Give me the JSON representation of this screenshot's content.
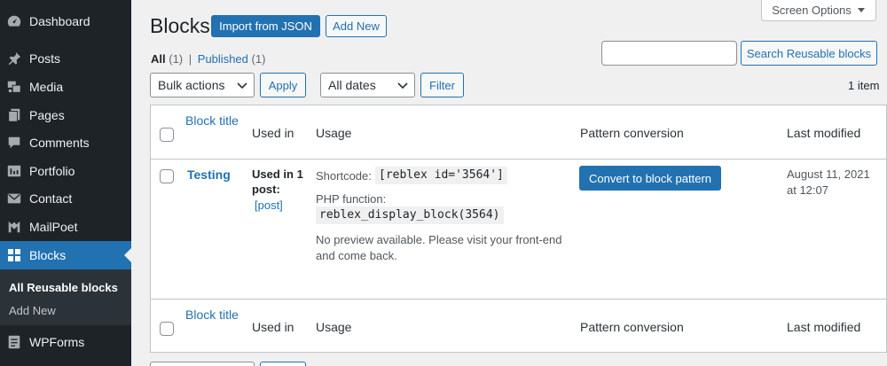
{
  "sidebar": {
    "items": [
      {
        "label": "Dashboard",
        "icon": "dashboard-icon"
      },
      {
        "label": "Posts",
        "icon": "pin-icon"
      },
      {
        "label": "Media",
        "icon": "media-icon"
      },
      {
        "label": "Pages",
        "icon": "pages-icon"
      },
      {
        "label": "Comments",
        "icon": "comment-icon"
      },
      {
        "label": "Portfolio",
        "icon": "portfolio-icon"
      },
      {
        "label": "Contact",
        "icon": "mail-icon"
      },
      {
        "label": "MailPoet",
        "icon": "mailpoet-icon"
      },
      {
        "label": "Blocks",
        "icon": "grid-icon"
      },
      {
        "label": "WPForms",
        "icon": "forms-icon"
      }
    ],
    "submenu": [
      "All Reusable blocks",
      "Add New"
    ]
  },
  "screen_options": "Screen Options",
  "page": {
    "title": "Blocks",
    "import_label": "Import from JSON",
    "add_new_label": "Add New"
  },
  "views": {
    "all_label": "All",
    "all_count": "(1)",
    "separator": "|",
    "published_label": "Published",
    "published_count": "(1)"
  },
  "search": {
    "value": "",
    "button_label": "Search Reusable blocks"
  },
  "filters": {
    "bulk_actions": "Bulk actions",
    "apply_label": "Apply",
    "dates": "All dates",
    "filter_label": "Filter",
    "item_count": "1 item"
  },
  "table": {
    "columns": {
      "title": "Block title",
      "used_in": "Used in",
      "usage": "Usage",
      "pattern": "Pattern conversion",
      "modified": "Last modified"
    },
    "rows": [
      {
        "title": "Testing",
        "used_in_line1": "Used in 1",
        "used_in_line2": "post:",
        "used_in_link": "[post]",
        "shortcode_label": "Shortcode:",
        "shortcode": "[reblex id='3564']",
        "php_label": "PHP function:",
        "php": "reblex_display_block(3564)",
        "preview_line1": "No preview available. Please visit your front-end",
        "preview_line2": "and come back.",
        "convert_label": "Convert to block pattern",
        "modified_line1": "August 11, 2021",
        "modified_line2": "at 12:07"
      }
    ]
  },
  "colors": {
    "accent": "#2271b1",
    "sidebar_bg": "#1d2327",
    "page_bg": "#f0f0f1"
  }
}
